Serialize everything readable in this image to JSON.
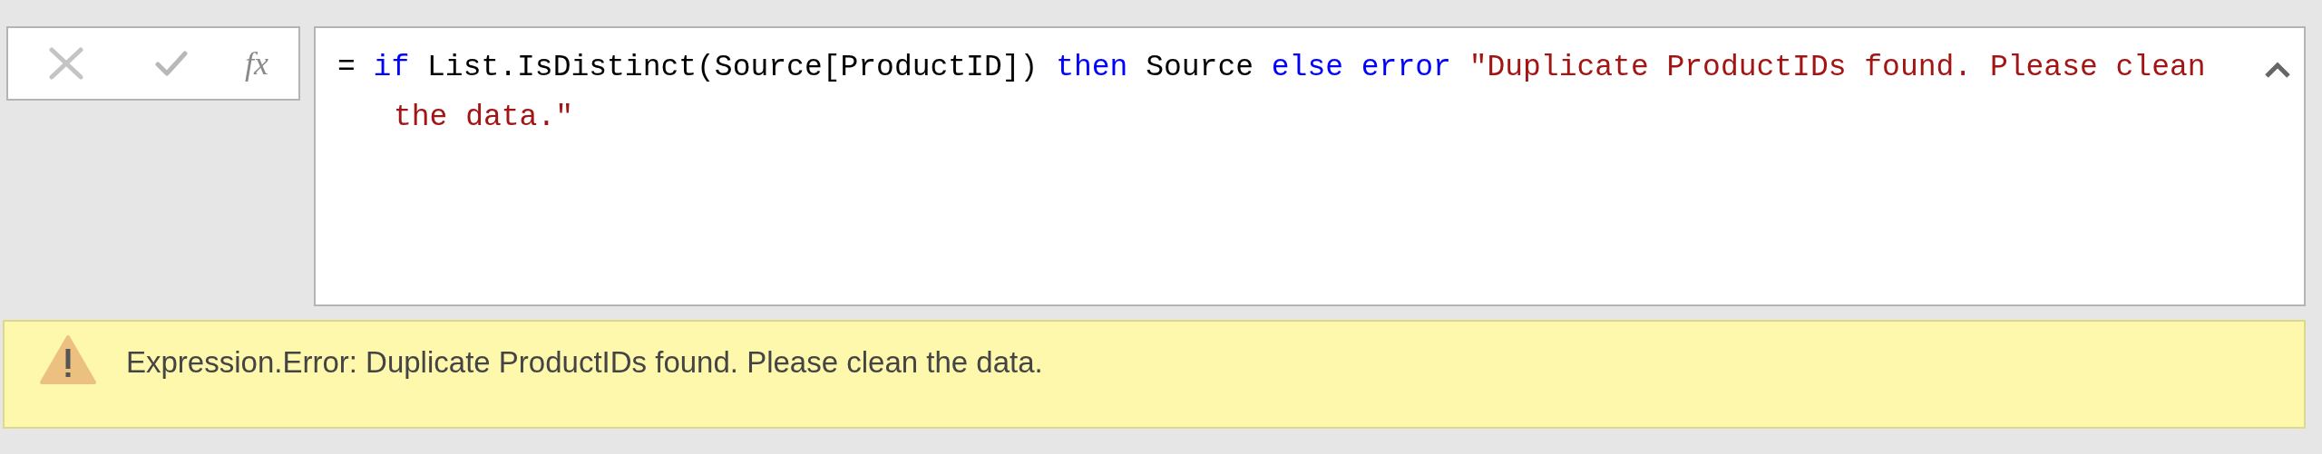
{
  "formula_bar": {
    "function_label": "fx",
    "lines": [
      [
        {
          "kind": "plain",
          "text": "= "
        },
        {
          "kind": "keyword",
          "text": "if"
        },
        {
          "kind": "plain",
          "text": " List.IsDistinct(Source[ProductID]) "
        },
        {
          "kind": "keyword",
          "text": "then"
        },
        {
          "kind": "plain",
          "text": " Source "
        },
        {
          "kind": "keyword",
          "text": "else"
        },
        {
          "kind": "keyword",
          "text": " error"
        },
        {
          "kind": "string",
          "text": " \"Duplicate ProductIDs found. Please clean"
        }
      ],
      [
        {
          "kind": "string",
          "text": "the data.\""
        }
      ]
    ]
  },
  "error_bar": {
    "message": "Expression.Error: Duplicate ProductIDs found. Please clean the data."
  }
}
